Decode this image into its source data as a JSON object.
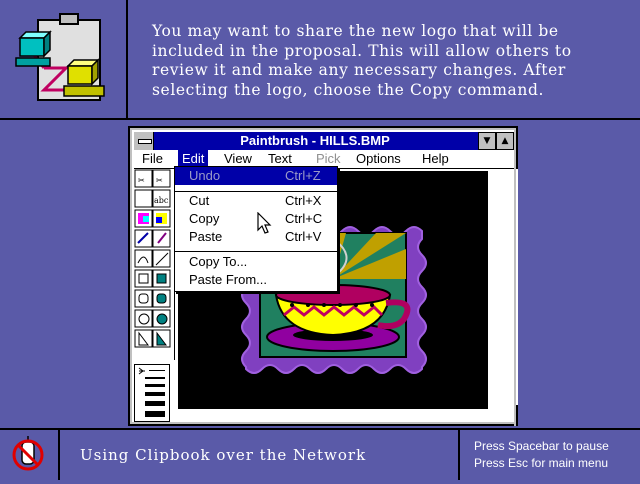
{
  "instruction": {
    "lines": [
      "You may want to share the new logo that will be",
      "included in the proposal.  This will allow others to",
      "review it and make any necessary changes.  After",
      "selecting the logo, choose the Copy command."
    ]
  },
  "window": {
    "title": "Paintbrush - HILLS.BMP",
    "minimize_glyph": "▼",
    "maximize_glyph": "▲"
  },
  "menubar": {
    "items": [
      "File",
      "Edit",
      "View",
      "Text",
      "Pick",
      "Options",
      "Help"
    ]
  },
  "edit_menu": {
    "items": [
      {
        "label": "Undo",
        "shortcut": "Ctrl+Z",
        "highlighted": true
      },
      {
        "label": "Cut",
        "shortcut": "Ctrl+X"
      },
      {
        "label": "Copy",
        "shortcut": "Ctrl+C"
      },
      {
        "label": "Paste",
        "shortcut": "Ctrl+V"
      },
      {
        "label": "Copy To...",
        "shortcut": ""
      },
      {
        "label": "Paste From...",
        "shortcut": ""
      }
    ]
  },
  "footer": {
    "title": "Using Clipbook over the Network",
    "help_line1": "Press Spacebar to pause",
    "help_line2": "Press Esc for main menu"
  },
  "colors": {
    "background": "#5a5aa8",
    "titlebar": "#0000a8",
    "highlight": "#0000a8"
  },
  "icons": {
    "top_left": "clipbook-computers-icon",
    "bottom_left": "no-mouse-icon",
    "cursor": "arrow-pointer-icon"
  }
}
